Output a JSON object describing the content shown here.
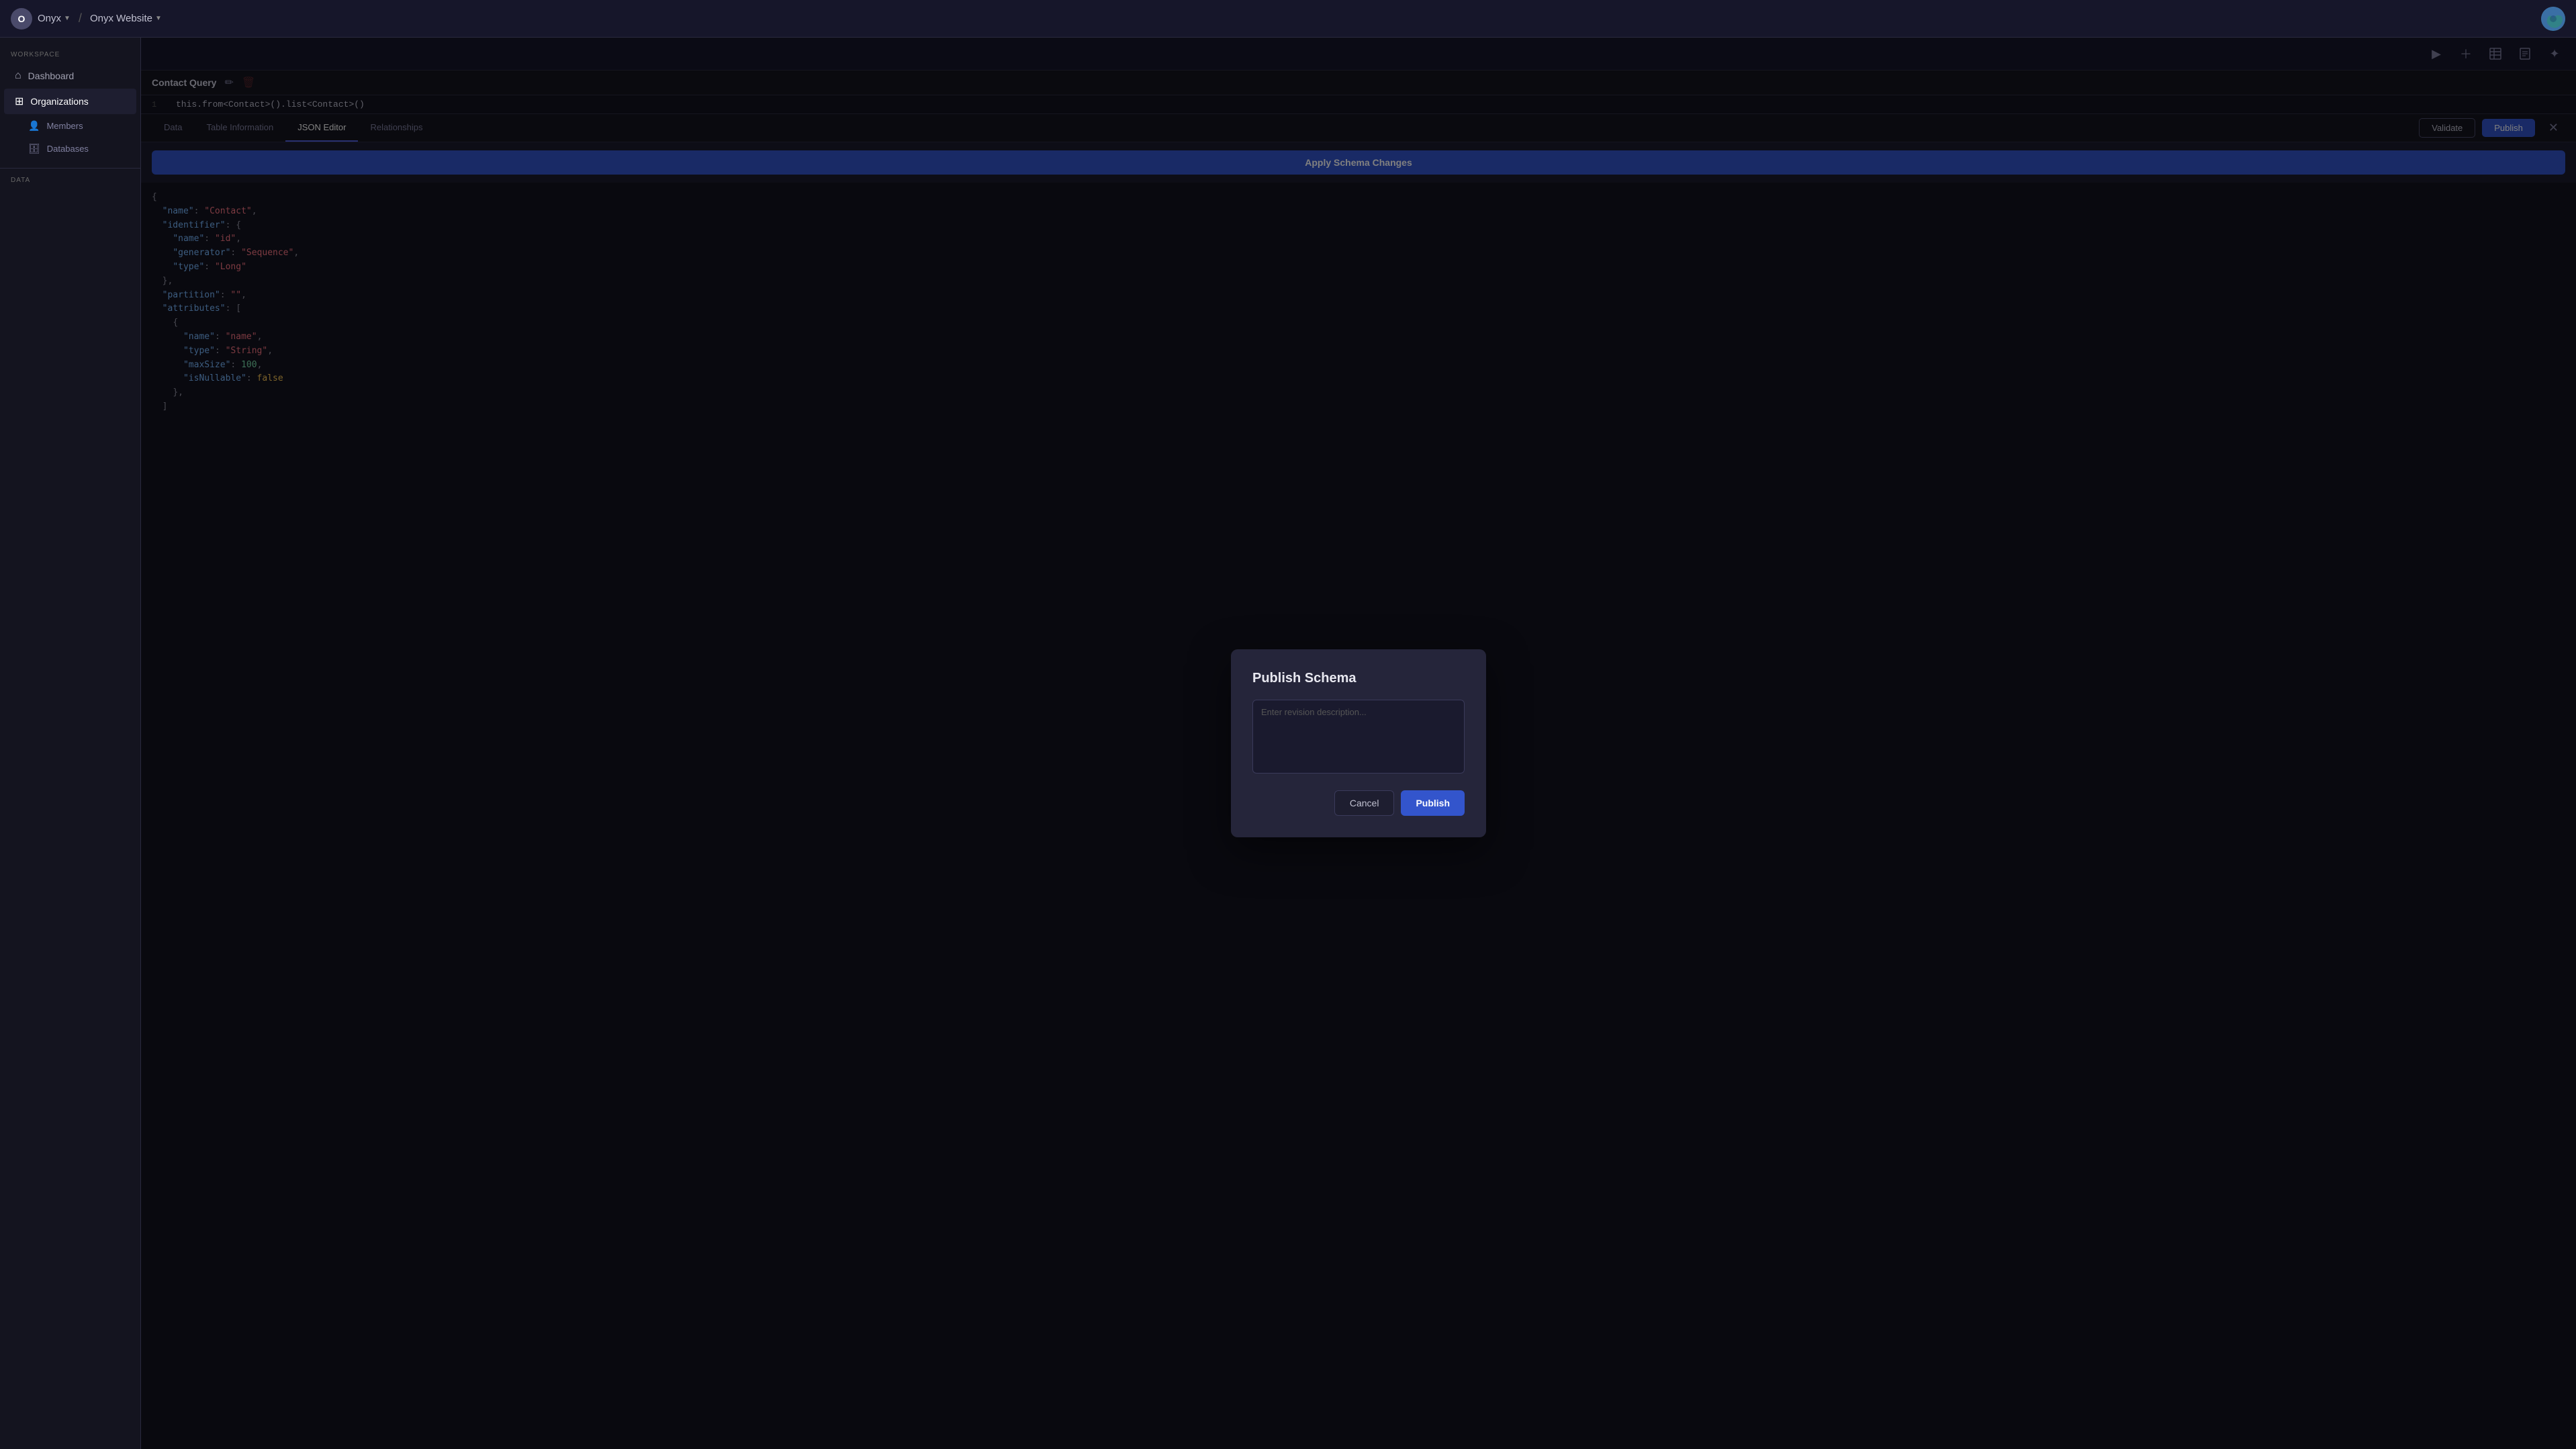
{
  "topbar": {
    "org_initial": "O",
    "org_name": "Onyx",
    "separator": "/",
    "project_name": "Onyx Website",
    "caret": "▼"
  },
  "sidebar": {
    "workspace_label": "WORKSPACE",
    "data_label": "DATA",
    "items": [
      {
        "id": "dashboard",
        "label": "Dashboard",
        "icon": "⌂"
      },
      {
        "id": "organizations",
        "label": "Organizations",
        "icon": "⊞",
        "active": true
      },
      {
        "id": "members",
        "label": "Members",
        "icon": "👤",
        "sub": true
      },
      {
        "id": "databases",
        "label": "Databases",
        "icon": "🗄",
        "sub": true
      }
    ]
  },
  "toolbar": {
    "icons": [
      {
        "id": "play-icon",
        "symbol": "▶"
      },
      {
        "id": "add-icon",
        "symbol": "+"
      },
      {
        "id": "table-icon",
        "symbol": "⊞"
      },
      {
        "id": "doc-icon",
        "symbol": "📄"
      },
      {
        "id": "magic-icon",
        "symbol": "✦"
      }
    ]
  },
  "code_bar": {
    "title": "Contact Query",
    "edit_icon": "✏",
    "delete_icon": "🗑",
    "line_number": "1",
    "code": "this.from<Contact>().list<Contact>()"
  },
  "tabs": {
    "items": [
      {
        "id": "data",
        "label": "Data",
        "active": false
      },
      {
        "id": "table-information",
        "label": "Table Information",
        "active": false
      },
      {
        "id": "json-editor",
        "label": "JSON Editor",
        "active": true
      },
      {
        "id": "relationships",
        "label": "Relationships",
        "active": false
      }
    ],
    "validate_label": "Validate",
    "publish_label": "Publish",
    "close_label": "✕"
  },
  "editor": {
    "apply_btn": "Apply Schema Changes",
    "code": "{\n  \"name\": \"Contact\",\n  \"identifier\": {\n    \"name\": \"id\",\n    \"generator\": \"Sequence\",\n    \"type\": \"Long\"\n  },\n  \"partition\": \"\",\n  \"attributes\": [\n    {\n      \"name\": \"name\",\n      \"type\": \"String\",\n      \"maxSize\": 100,\n      \"isNullable\": false\n    },\n  ]"
  },
  "modal": {
    "title": "Publish Schema",
    "textarea_placeholder": "Enter revision description...",
    "cancel_label": "Cancel",
    "publish_label": "Publish"
  }
}
